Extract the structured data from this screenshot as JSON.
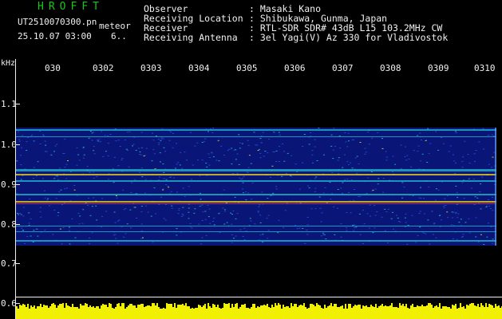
{
  "header": {
    "logo": "HROFFT",
    "filename": "UT2510070300.pn",
    "kind": "meteor",
    "datetime": "25.10.07 03:00",
    "extra": "6..",
    "info": [
      {
        "label": "Observer",
        "value": ": Masaki Kano"
      },
      {
        "label": "Receiving Location",
        "value": ": Shibukawa, Gunma, Japan"
      },
      {
        "label": "Receiver",
        "value": ": RTL-SDR SDR# 43dB L15 103.2MHz CW"
      },
      {
        "label": "Receiving Antenna",
        "value": ": 3el Yagi(V) Az 330 for Vladivostok"
      }
    ]
  },
  "axis": {
    "unit": "kHz",
    "x_ticks": [
      "030",
      "0302",
      "0303",
      "0304",
      "0305",
      "0306",
      "0307",
      "0308",
      "0309",
      "0310"
    ],
    "y_ticks": [
      "1.1",
      "1.0",
      "0.9",
      "0.8",
      "0.7",
      "0.6"
    ]
  },
  "colors": {
    "background": "#000000",
    "spectrum_base": "#0a1a8c",
    "signal_mid": "#1fb4c8",
    "signal_hot": "#e8d020",
    "signal_peak": "#ff3030",
    "power_bar": "#f0f000",
    "logo": "#18c818",
    "text": "#f0f0f0"
  }
}
